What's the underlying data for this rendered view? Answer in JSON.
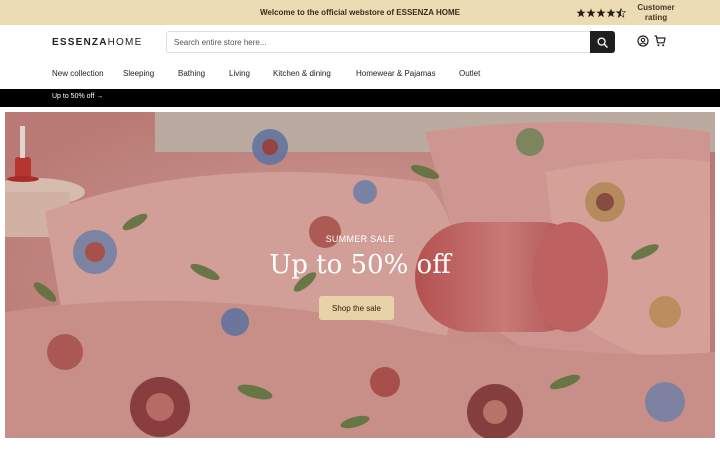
{
  "announcement": {
    "welcome": "Welcome to the official webstore of ESSENZA HOME",
    "rating_label": "Customer rating",
    "stars": 4.5
  },
  "header": {
    "logo_bold": "ESSENZA",
    "logo_light": "HOME",
    "search_placeholder": "Search entire store here...",
    "icons": [
      "search-icon",
      "account-icon",
      "cart-icon"
    ]
  },
  "nav": {
    "items": [
      "New collection",
      "Sleeping",
      "Bathing",
      "Living",
      "Kitchen & dining",
      "Homewear & Pajamas",
      "Outlet"
    ]
  },
  "promo": {
    "text": "Up to 50% off →"
  },
  "hero": {
    "kicker": "SUMMER SALE",
    "title": "Up to 50% off",
    "cta": "Shop the sale"
  },
  "colors": {
    "announcement_bg": "#ecdcb4",
    "promo_bg": "#000000",
    "cta_bg": "#e8d3a8",
    "hero_pink": "#d69b96"
  }
}
